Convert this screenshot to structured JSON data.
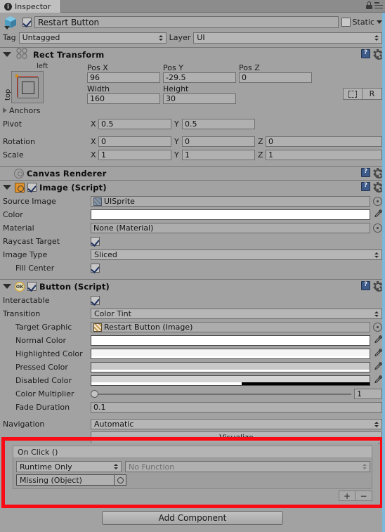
{
  "window": {
    "tab_label": "Inspector",
    "tab_icon": "info-icon",
    "lock_icon": "lock-icon",
    "menu_icon": "hamburger-menu-icon"
  },
  "gameobject": {
    "icon": "gameobject-cube-icon",
    "enabled": true,
    "name": "Restart Button",
    "static_label": "Static",
    "tag_label": "Tag",
    "tag_value": "Untagged",
    "layer_label": "Layer",
    "layer_value": "UI"
  },
  "rect_transform": {
    "title": "Rect Transform",
    "anchor_preset": {
      "top_label": "left",
      "left_label": "top"
    },
    "pos_x_label": "Pos X",
    "pos_y_label": "Pos Y",
    "pos_z_label": "Pos Z",
    "pos_x": "96",
    "pos_y": "-29.5",
    "pos_z": "0",
    "width_label": "Width",
    "height_label": "Height",
    "width": "160",
    "height": "30",
    "blueprint_button": "blueprint-mode-icon",
    "raw_button": "R",
    "anchors_label": "Anchors",
    "pivot_label": "Pivot",
    "pivot_x": "0.5",
    "pivot_y": "0.5",
    "rotation_label": "Rotation",
    "rotation_x": "0",
    "rotation_y": "0",
    "rotation_z": "0",
    "scale_label": "Scale",
    "scale_x": "1",
    "scale_y": "1",
    "scale_z": "1",
    "axis_x": "X",
    "axis_y": "Y",
    "axis_z": "Z"
  },
  "canvas_renderer": {
    "title": "Canvas Renderer"
  },
  "image": {
    "title": "Image (Script)",
    "enabled": true,
    "source_image_label": "Source Image",
    "source_image_value": "UISprite",
    "color_label": "Color",
    "color_value": "#ffffff",
    "material_label": "Material",
    "material_value": "None (Material)",
    "raycast_target_label": "Raycast Target",
    "raycast_target": true,
    "image_type_label": "Image Type",
    "image_type_value": "Sliced",
    "fill_center_label": "Fill Center",
    "fill_center": true
  },
  "button": {
    "title": "Button (Script)",
    "enabled": true,
    "interactable_label": "Interactable",
    "interactable": true,
    "transition_label": "Transition",
    "transition_value": "Color Tint",
    "target_graphic_label": "Target Graphic",
    "target_graphic_value": "Restart Button (Image)",
    "normal_color_label": "Normal Color",
    "normal_color_value": "#ffffff",
    "highlighted_color_label": "Highlighted Color",
    "highlighted_color_value": "#f5f5f5",
    "pressed_color_label": "Pressed Color",
    "pressed_color_value": "#c8c8c8",
    "disabled_color_label": "Disabled Color",
    "disabled_color_value": "#c8c8c8",
    "disabled_color_alpha": "50",
    "color_multiplier_label": "Color Multiplier",
    "color_multiplier_value": "1",
    "fade_duration_label": "Fade Duration",
    "fade_duration_value": "0.1",
    "navigation_label": "Navigation",
    "navigation_value": "Automatic",
    "visualize_label": "Visualize"
  },
  "on_click": {
    "title": "On Click ()",
    "mode_value": "Runtime Only",
    "function_value": "No Function",
    "object_value": "Missing (Object)",
    "add_label": "+",
    "remove_label": "−",
    "highlight_color": "#fa0a14"
  },
  "footer": {
    "add_component_label": "Add Component"
  }
}
